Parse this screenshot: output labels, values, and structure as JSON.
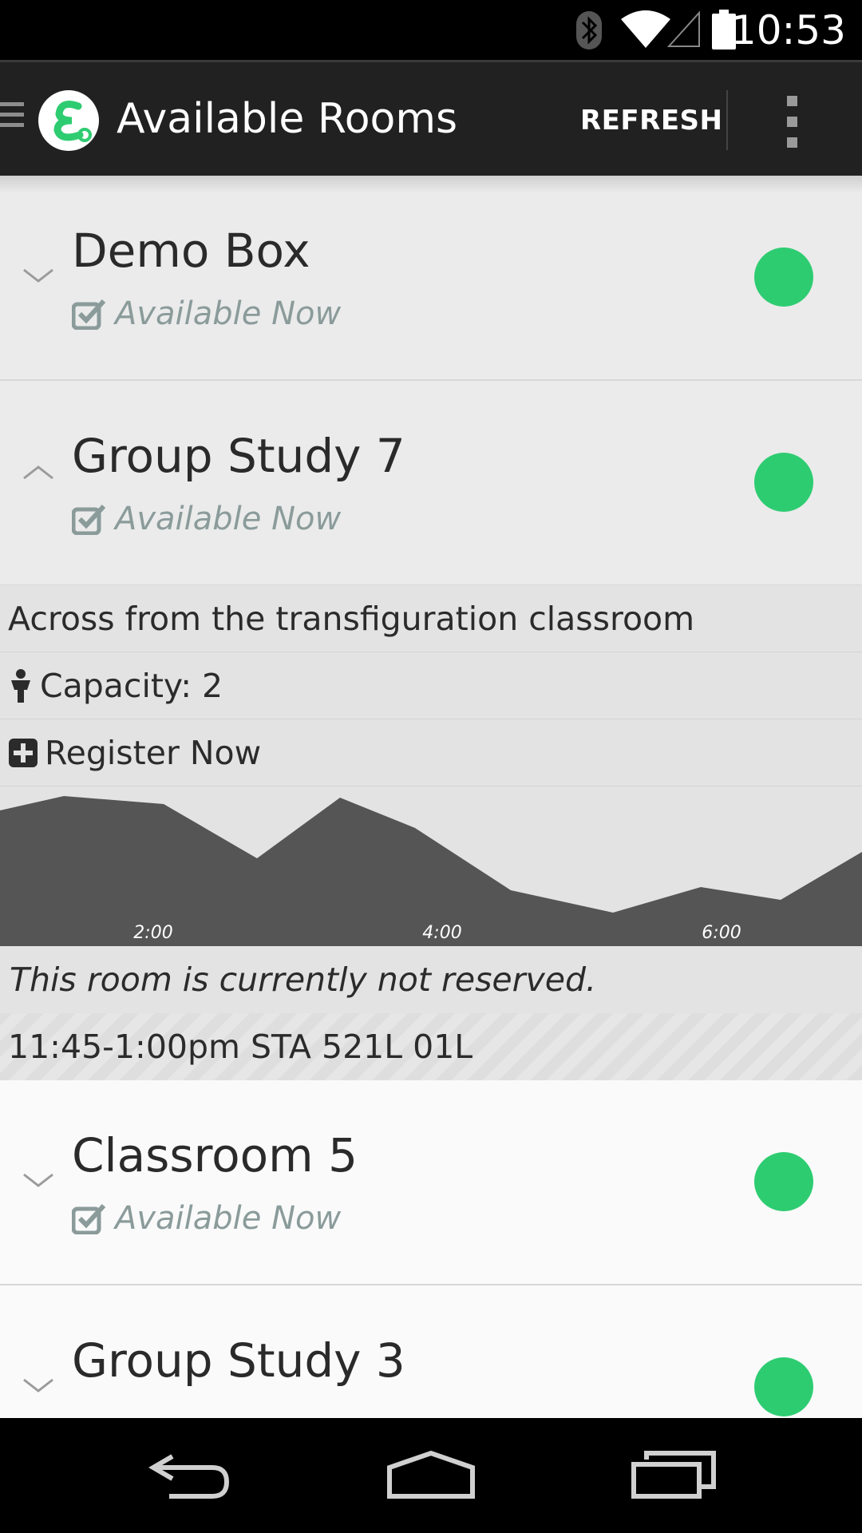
{
  "status_bar": {
    "time": "10:53",
    "icons": [
      "bluetooth-icon",
      "wifi-icon",
      "cell-signal-icon",
      "battery-icon"
    ]
  },
  "action_bar": {
    "title": "Available Rooms",
    "refresh_label": "REFRESH",
    "drawer_icon": "hamburger-icon",
    "logo_icon": "app-logo-icon",
    "overflow_icon": "more-vertical-icon"
  },
  "rooms": [
    {
      "name": "Demo Box",
      "availability": "Available Now",
      "expanded": false,
      "status_color": "#2ecc71"
    },
    {
      "name": "Group Study 7",
      "availability": "Available Now",
      "expanded": true,
      "status_color": "#2ecc71"
    },
    {
      "name": "Classroom 5",
      "availability": "Available Now",
      "expanded": false,
      "status_color": "#2ecc71"
    },
    {
      "name": "Group Study 3",
      "availability": "",
      "expanded": false,
      "status_color": "#2ecc71"
    }
  ],
  "expanded_detail": {
    "location": "Across from the transfiguration classroom",
    "capacity": "Capacity: 2",
    "register": "Register Now",
    "graph_ticks": [
      "2:00",
      "4:00",
      "6:00"
    ],
    "reservation_note": "This room is currently not reserved.",
    "schedule": "11:45-1:00pm STA 521L 01L"
  },
  "colors": {
    "accent_green": "#2ecc71",
    "action_bar_bg": "#212121",
    "graph_fill": "#555555"
  },
  "nav_bar": {
    "back_icon": "back-icon",
    "home_icon": "home-icon",
    "recents_icon": "recents-icon"
  }
}
